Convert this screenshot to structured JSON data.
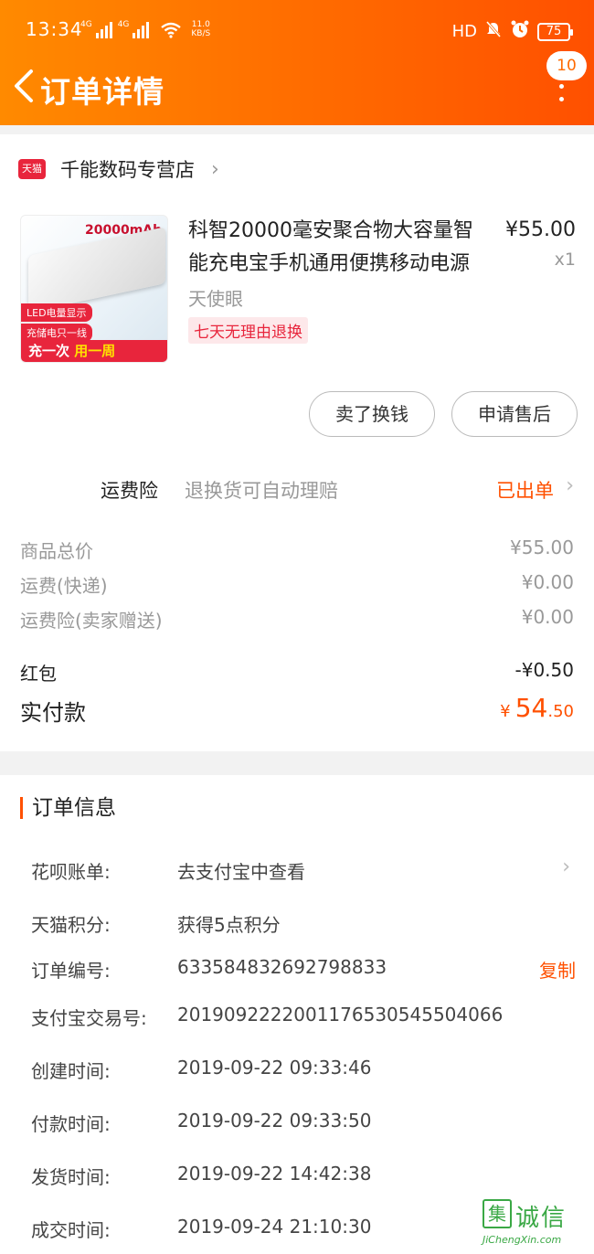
{
  "status_bar": {
    "time": "13:34",
    "net1": "4G",
    "net2": "4G",
    "speed_value": "11.0",
    "speed_unit": "KB/S",
    "hd": "HD",
    "battery": "75"
  },
  "nav": {
    "title": "订单详情",
    "message_count": "10"
  },
  "shop": {
    "logo_text": "天猫",
    "name": "千能数码专营店"
  },
  "product": {
    "image_caption": "20000mAh",
    "image_tag1": "LED电量显示",
    "image_tag2": "充储电只一线",
    "image_banner_a": "充一次",
    "image_banner_b": "用一周",
    "title": "科智20000毫安聚合物大容量智能充电宝手机通用便携移动电源",
    "price": "¥55.00",
    "quantity": "x1",
    "spec": "天使眼",
    "return_tag": "七天无理由退换"
  },
  "actions": {
    "sell_label": "卖了换钱",
    "after_sale_label": "申请售后"
  },
  "insurance": {
    "label": "运费险",
    "desc": "退换货可自动理赔",
    "status": "已出单"
  },
  "summary": {
    "goods_total_label": "商品总价",
    "goods_total_value": "¥55.00",
    "shipping_label": "运费(快递)",
    "shipping_value": "¥0.00",
    "ins_fee_label": "运费险(卖家赠送)",
    "ins_fee_value": "¥0.00",
    "coupon_label": "红包",
    "coupon_value": "-¥0.50",
    "paid_label": "实付款",
    "paid_currency": "¥",
    "paid_int": "54",
    "paid_dec": ".50"
  },
  "order_info": {
    "title": "订单信息",
    "huabei_label": "花呗账单:",
    "huabei_value": "去支付宝中查看",
    "points_label": "天猫积分:",
    "points_value": "获得5点积分",
    "order_no_label": "订单编号:",
    "order_no_value": "633584832692798833",
    "copy_label": "复制",
    "alipay_no_label": "支付宝交易号:",
    "alipay_no_value": "2019092222001176530545504066",
    "created_label": "创建时间:",
    "created_value": "2019-09-22 09:33:46",
    "paid_time_label": "付款时间:",
    "paid_time_value": "2019-09-22 09:33:50",
    "shipped_label": "发货时间:",
    "shipped_value": "2019-09-22 14:42:38",
    "done_label": "成交时间:",
    "done_value": "2019-09-24 21:10:30"
  },
  "watermark": {
    "mark": "集",
    "text": "诚信",
    "url": "JiChengXin.com"
  },
  "colors": {
    "brand_orange": "#ff5000",
    "tmall_red": "#e8253c"
  }
}
